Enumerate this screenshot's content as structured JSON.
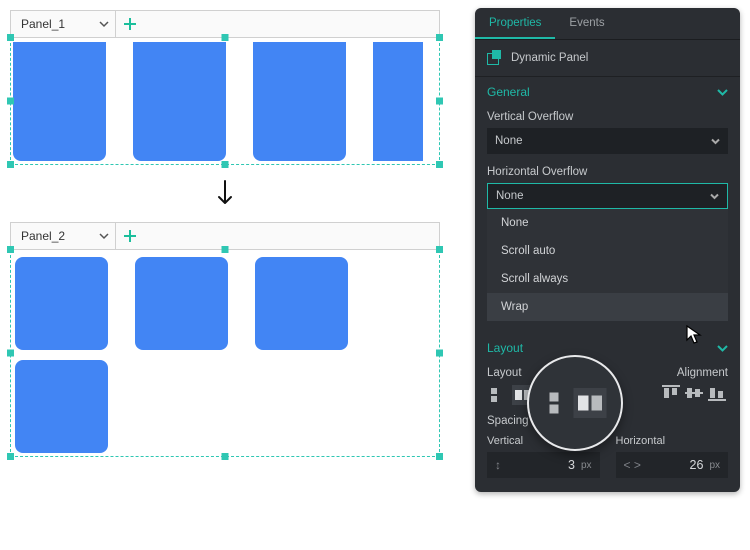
{
  "panels": {
    "panel1_name": "Panel_1",
    "panel2_name": "Panel_2"
  },
  "side": {
    "tabs": {
      "properties": "Properties",
      "events": "Events"
    },
    "element_title": "Dynamic Panel",
    "section_general": "General",
    "section_layout": "Layout",
    "field_vertical_overflow": "Vertical Overflow",
    "field_horizontal_overflow": "Horizontal Overflow",
    "overflow_value": "None",
    "overflow_options": [
      "None",
      "Scroll auto",
      "Scroll always",
      "Wrap"
    ],
    "layout_legend_layout": "Layout",
    "layout_legend_alignment": "Alignment",
    "spacing_legend": "Spacing",
    "spacing_vertical_label": "Vertical",
    "spacing_horizontal_label": "Horizontal",
    "spacing_vertical_value": "3",
    "spacing_horizontal_value": "26",
    "spacing_unit": "px"
  }
}
